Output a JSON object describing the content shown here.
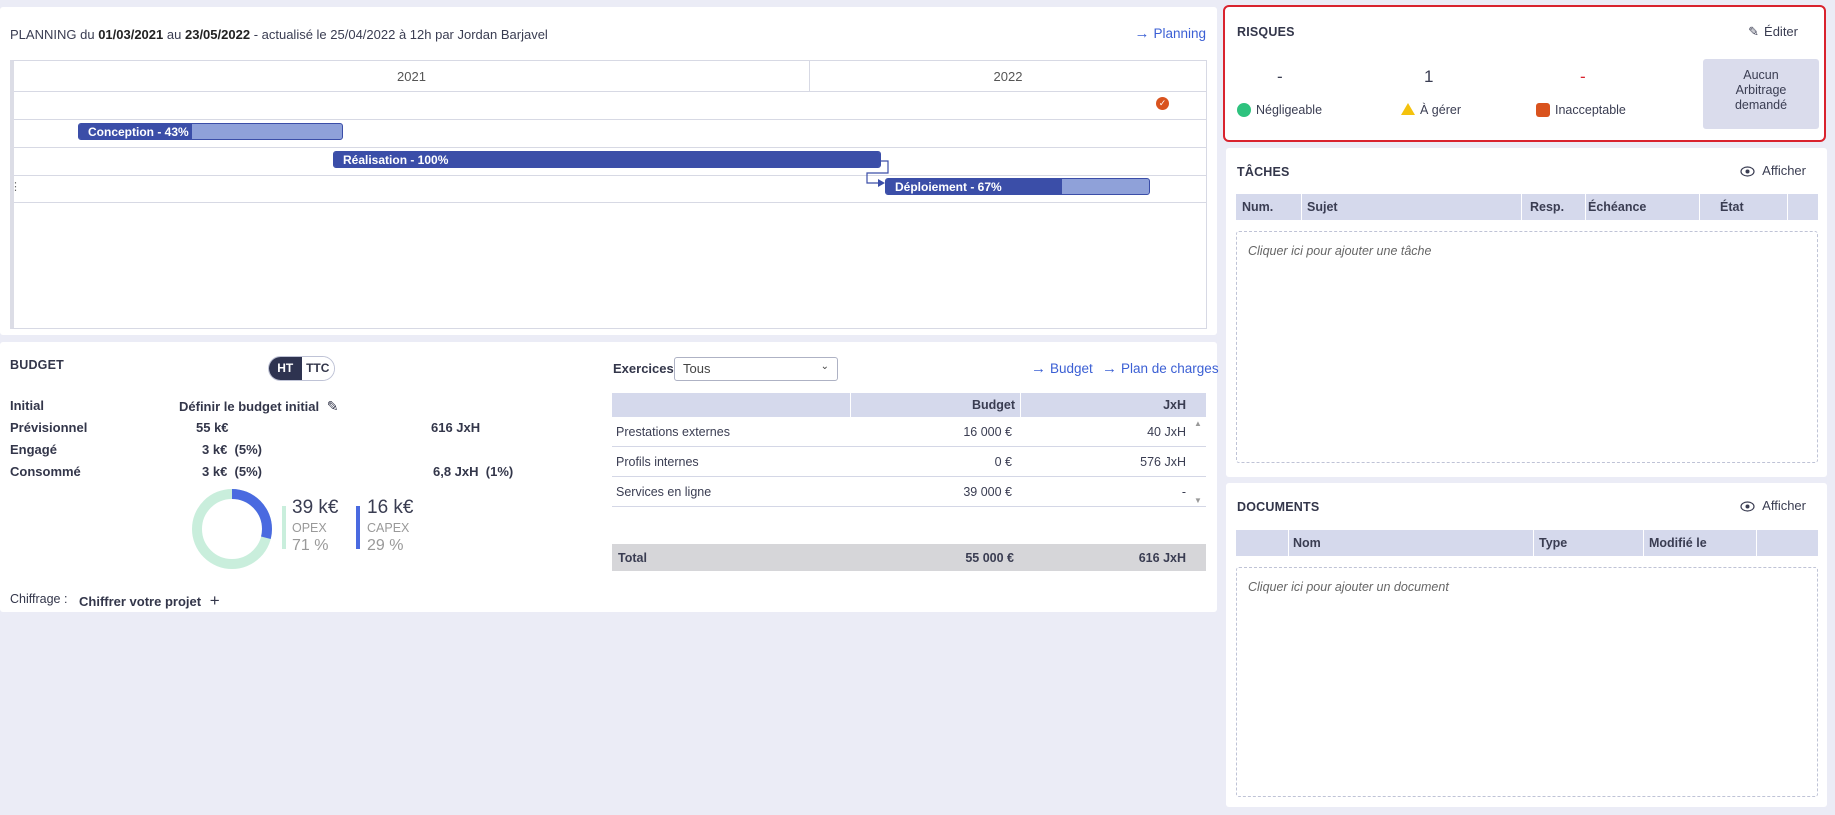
{
  "planning": {
    "label": "PLANNING",
    "du": "du",
    "start": "01/03/2021",
    "au": "au",
    "end": "23/05/2022",
    "updated": "- actualisé le 25/04/2022 à 12h par Jordan Barjavel",
    "link": "Planning",
    "years": [
      "2021",
      "2022"
    ],
    "tasks": [
      {
        "label": "Conception - 43%",
        "progress": 0.43
      },
      {
        "label": "Réalisation - 100%",
        "progress": 1.0
      },
      {
        "label": "Déploiement - 67%",
        "progress": 0.67
      }
    ],
    "milestone_color": "#d9531e"
  },
  "budget": {
    "title": "BUDGET",
    "toggle": {
      "ht": "HT",
      "ttc": "TTC",
      "selected": "HT"
    },
    "rows": [
      {
        "label": "Initial",
        "value": "Définir le budget initial",
        "jxh": ""
      },
      {
        "label": "Prévisionnel",
        "value": "55 k€",
        "jxh": "616 JxH"
      },
      {
        "label": "Engagé",
        "value": "3 k€  (5%)",
        "jxh": ""
      },
      {
        "label": "Consommé",
        "value": "3 k€  (5%)",
        "jxh": "6,8 JxH  (1%)"
      }
    ],
    "opex": {
      "value": "39 k€",
      "label": "OPEX",
      "pct": "71 %"
    },
    "capex": {
      "value": "16 k€",
      "label": "CAPEX",
      "pct": "29 %"
    },
    "donut": {
      "opex_fraction": 0.71,
      "capex_fraction": 0.29,
      "opex_color": "#c9eedc",
      "capex_color": "#4a6ae0"
    },
    "chiffrage_label": "Chiffrage :",
    "chiffrage_action": "Chiffrer votre projet",
    "exercices_label": "Exercices",
    "exercices_value": "Tous",
    "link_budget": "Budget",
    "link_charges": "Plan de charges",
    "table": {
      "headers": [
        "Budget",
        "JxH"
      ],
      "rows": [
        {
          "name": "Prestations externes",
          "budget": "16 000 €",
          "jxh": "40 JxH"
        },
        {
          "name": "Profils internes",
          "budget": "0 €",
          "jxh": "576 JxH"
        },
        {
          "name": "Services en ligne",
          "budget": "39 000 €",
          "jxh": "-"
        }
      ],
      "total": {
        "name": "Total",
        "budget": "55 000 €",
        "jxh": "616 JxH"
      }
    }
  },
  "risques": {
    "title": "RISQUES",
    "edit": "Éditer",
    "items": [
      {
        "count": "-",
        "label": "Négligeable",
        "color": "#2ec27e"
      },
      {
        "count": "1",
        "label": "À gérer",
        "color": "#f4c20d"
      },
      {
        "count": "-",
        "label": "Inacceptable",
        "color": "#d9531e"
      }
    ],
    "arbitrage": [
      "Aucun",
      "Arbitrage",
      "demandé"
    ],
    "highlight_color": "#d9232e"
  },
  "taches": {
    "title": "TÂCHES",
    "show": "Afficher",
    "headers": [
      "Num.",
      "Sujet",
      "Resp.",
      "Échéance",
      "État"
    ],
    "placeholder": "Cliquer ici pour ajouter une tâche"
  },
  "documents": {
    "title": "DOCUMENTS",
    "show": "Afficher",
    "headers": [
      "Nom",
      "Type",
      "Modifié le"
    ],
    "placeholder": "Cliquer ici pour ajouter un document"
  }
}
